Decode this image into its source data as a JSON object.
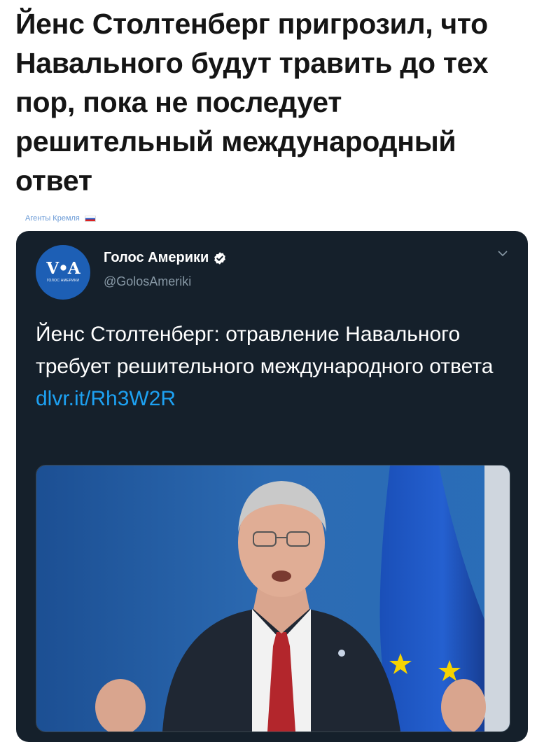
{
  "headline": "Йенс Столтенберг пригрозил, что Навального будут травить до тех пор, пока не последует решительный международный ответ",
  "source": "Агенты Кремля",
  "tweet": {
    "avatar_mark": "V•A",
    "avatar_sub": "ГОЛОС АМЕРИКИ",
    "author_name": "Голос Америки",
    "handle": "@GolosAmeriki",
    "text": "Йенс Столтенберг: отравление Навального требует решительного международного ответа",
    "link": "dlvr.it/Rh3W2R"
  },
  "colors": {
    "tweet_bg": "#15202b",
    "link": "#1da1f2",
    "handle": "#8899a6",
    "avatar": "#1d5fb5",
    "eu_flag": "#1f57c4",
    "star": "#f5d300",
    "tie": "#b3262c"
  },
  "icons": [
    "verified-badge-icon",
    "chevron-down-icon",
    "russia-flag-icon"
  ]
}
